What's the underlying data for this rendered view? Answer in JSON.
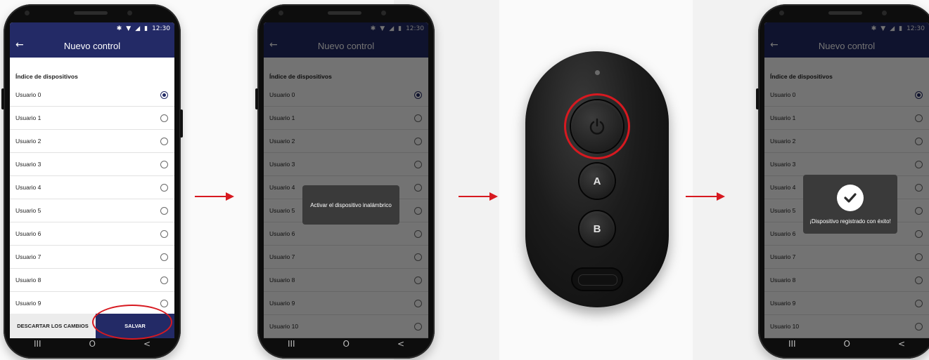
{
  "status": {
    "time": "12:30",
    "icons": [
      "bluetooth-icon",
      "wifi-icon",
      "signal-icon",
      "battery-icon"
    ]
  },
  "app": {
    "title": "Nuevo control",
    "section_title": "Índice de dispositivos"
  },
  "screen1": {
    "users": [
      "Usuario 0",
      "Usuario 1",
      "Usuario 2",
      "Usuario 3",
      "Usuario 4",
      "Usuario 5",
      "Usuario 6",
      "Usuario 7",
      "Usuario 8",
      "Usuario 9"
    ],
    "selected": 0,
    "discard_label": "DESCARTAR LOS CAMBIOS",
    "save_label": "SALVAR"
  },
  "screen2": {
    "users": [
      "Usuario 0",
      "Usuario 1",
      "Usuario 2",
      "Usuario 3",
      "Usuario 4",
      "Usuario 5",
      "Usuario 6",
      "Usuario 7",
      "Usuario 8",
      "Usuario 9",
      "Usuario 10"
    ],
    "selected": 0,
    "toast": "Activar el dispositivo inalámbrico"
  },
  "remote": {
    "button_a": "A",
    "button_b": "B",
    "power_icon": "power-icon"
  },
  "screen4": {
    "users": [
      "Usuario 0",
      "Usuario 1",
      "Usuario 2",
      "Usuario 3",
      "Usuario 4",
      "Usuario 5",
      "Usuario 6",
      "Usuario 7",
      "Usuario 8",
      "Usuario 9",
      "Usuario 10"
    ],
    "selected": 0,
    "toast": "¡Dispositivo registrado con éxito!"
  },
  "navbar": {
    "recent": "III",
    "home": "O",
    "back": "<"
  },
  "colors": {
    "accent": "#232a66",
    "highlight": "#d71920"
  }
}
